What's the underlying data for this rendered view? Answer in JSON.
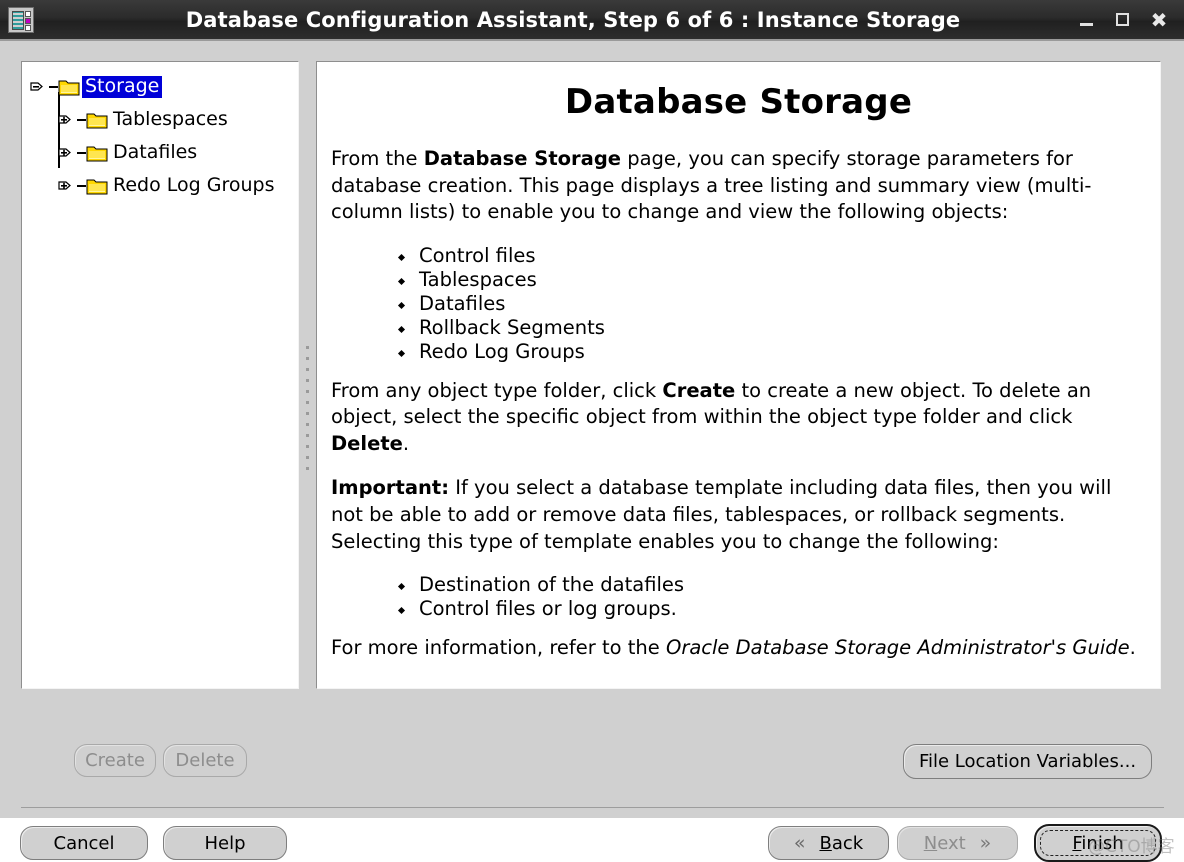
{
  "window": {
    "title": "Database Configuration Assistant, Step 6 of 6 : Instance Storage",
    "app_icon": "database-app-icon",
    "minimize_label": "",
    "maximize_label": "",
    "close_label": "✖"
  },
  "tree": {
    "root": {
      "label": "Storage",
      "expanded": true,
      "selected": true,
      "toggle_icon": "circle-minus-icon",
      "folder_icon": "folder-icon"
    },
    "children": [
      {
        "label": "Tablespaces",
        "toggle_icon": "circle-plus-icon",
        "folder_icon": "folder-icon"
      },
      {
        "label": "Datafiles",
        "toggle_icon": "circle-plus-icon",
        "folder_icon": "folder-icon"
      },
      {
        "label": "Redo Log Groups",
        "toggle_icon": "circle-plus-icon",
        "folder_icon": "folder-icon"
      }
    ]
  },
  "doc": {
    "title": "Database Storage",
    "p1_pre": "From the ",
    "p1_bold": "Database Storage",
    "p1_post": " page, you can specify storage parameters for database creation. This page displays a tree listing and summary view (multi-column lists) to enable you to change and view the following objects:",
    "list1": [
      "Control files",
      "Tablespaces",
      "Datafiles",
      "Rollback Segments",
      "Redo Log Groups"
    ],
    "p2_pre": "From any object type folder, click ",
    "p2_bold1": "Create",
    "p2_mid": " to create a new object. To delete an object, select the specific object from within the object type folder and click ",
    "p2_bold2": "Delete",
    "p2_post": ".",
    "p3_bold": "Important:",
    "p3_text": " If you select a database template including data files, then you will not be able to add or remove data files, tablespaces, or rollback segments. Selecting this type of template enables you to change the following:",
    "list2": [
      "Destination of the datafiles",
      "Control files or log groups."
    ],
    "p4_pre": "For more information, refer to the ",
    "p4_italic": "Oracle Database Storage Administrator's Guide",
    "p4_post": "."
  },
  "buttons": {
    "create": "Create",
    "delete": "Delete",
    "file_location_variables": "File Location Variables...",
    "cancel": "Cancel",
    "help": "Help",
    "back": "Back",
    "back_mnemonic": "B",
    "back_rest": "ack",
    "back_icon": "chevron-left-double-icon",
    "next": "Next",
    "next_mnemonic": "N",
    "next_rest": "ext",
    "next_icon": "chevron-right-double-icon",
    "finish": "Finish",
    "finish_mnemonic": "F",
    "finish_rest": "inish"
  },
  "states": {
    "create_enabled": false,
    "delete_enabled": false,
    "next_enabled": false,
    "finish_focused": true
  },
  "watermark": "@CTO博客",
  "colors": {
    "titlebar": "#2b2b2b",
    "window_bg": "#d0d0d0",
    "panel_bg": "#ffffff",
    "selection_blue": "#0000d8",
    "folder_yellow": "#ffd700",
    "disabled_text": "#8d8d8d"
  }
}
